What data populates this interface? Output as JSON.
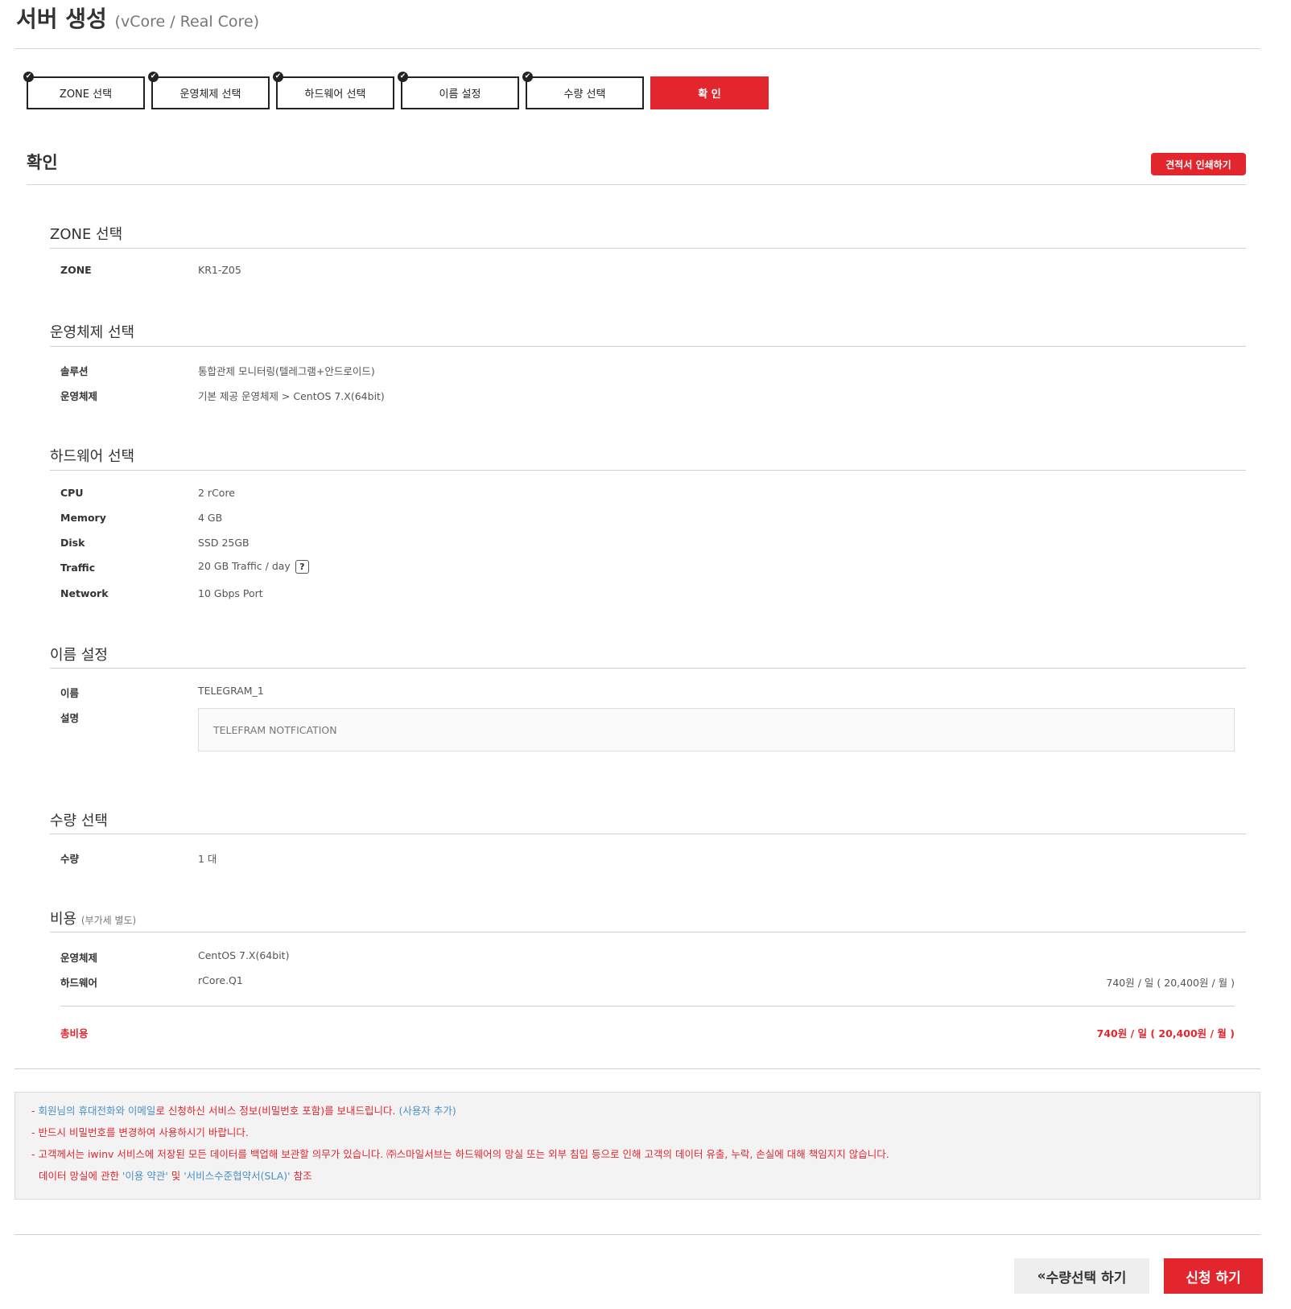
{
  "header": {
    "title": "서버 생성",
    "subtitle": "(vCore / Real Core)"
  },
  "steps": [
    {
      "label": "ZONE 선택",
      "done": true
    },
    {
      "label": "운영체제 선택",
      "done": true
    },
    {
      "label": "하드웨어 선택",
      "done": true
    },
    {
      "label": "이름 설정",
      "done": true
    },
    {
      "label": "수량 선택",
      "done": true
    },
    {
      "label": "확  인",
      "done": false,
      "active": true
    }
  ],
  "confirm": {
    "title": "확인",
    "print_button": "견적서 인쇄하기"
  },
  "zone": {
    "title": "ZONE 선택",
    "rows": [
      {
        "label": "ZONE",
        "value": "KR1-Z05"
      }
    ]
  },
  "os": {
    "title": "운영체제 선택",
    "rows": [
      {
        "label": "솔루션",
        "value": "통합관제 모니터링(텔레그램+안드로이드)"
      },
      {
        "label": "운영체제",
        "value": "기본 제공 운영체제 > CentOS 7.X(64bit)"
      }
    ]
  },
  "hardware": {
    "title": "하드웨어 선택",
    "rows": [
      {
        "label": "CPU",
        "value": "2 rCore"
      },
      {
        "label": "Memory",
        "value": "4 GB"
      },
      {
        "label": "Disk",
        "value": "SSD 25GB"
      },
      {
        "label": "Traffic",
        "value": "20 GB Traffic / day"
      },
      {
        "label": "Network",
        "value": "10 Gbps Port"
      }
    ],
    "help_icon": "?"
  },
  "name": {
    "title": "이름 설정",
    "rows": [
      {
        "label": "이름",
        "value": "TELEGRAM_1"
      },
      {
        "label": "설명",
        "value": "TELEFRAM NOTFICATION"
      }
    ]
  },
  "quantity": {
    "title": "수량 선택",
    "rows": [
      {
        "label": "수량",
        "value": "1 대"
      }
    ]
  },
  "cost": {
    "title": "비용",
    "note": "(부가세 별도)",
    "rows": [
      {
        "label": "운영체제",
        "value": "CentOS 7.X(64bit)",
        "price": ""
      },
      {
        "label": "하드웨어",
        "value": "rCore.Q1",
        "price": "740원 / 일 ( 20,400원 / 월 )"
      }
    ],
    "total_label": "총비용",
    "total_value": "740원 / 일 ( 20,400원 / 월 )"
  },
  "notice": {
    "line1_a": "- ",
    "line1_b": "회원님의 휴대전화와 이메일",
    "line1_c": "로 신청하신 서비스 정보(비밀번호 포함)를 보내드립니다. ",
    "line1_d": "(사용자 추가)",
    "line2": "- 반드시 비밀번호를 변경하여 사용하시기 바랍니다.",
    "line3": "- 고객께서는 iwinv 서비스에 저장된 모든 데이터를 백업해 보관할 의무가 있습니다. ㈜스마일서브는 하드웨어의 망실 또는 외부 침입 등으로 인해 고객의 데이터 유출, 누락, 손실에 대해 책임지지 않습니다.",
    "line4_a": "데이터 망실에 관한 ",
    "line4_b": "'이용 약관'",
    "line4_c": " 및 ",
    "line4_d": "'서비스수준협약서(SLA)'",
    "line4_e": " 참조"
  },
  "actions": {
    "back_icon": "«",
    "back_label": "수량선택 하기",
    "apply_label": "신청 하기"
  },
  "colors": {
    "accent": "#e3262e",
    "link": "#4a90c8"
  }
}
